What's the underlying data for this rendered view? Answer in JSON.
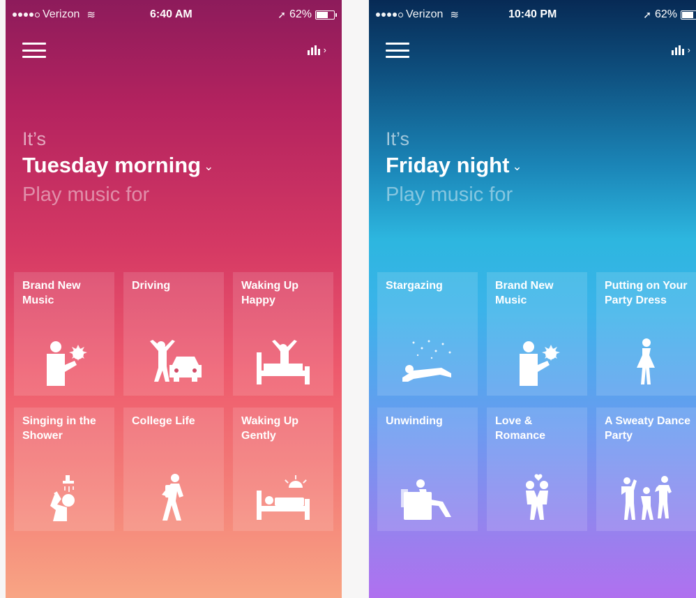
{
  "phones": [
    {
      "status": {
        "carrier": "Verizon",
        "time": "6:40 AM",
        "battery": "62%"
      },
      "greeting": {
        "its": "It’s",
        "period": "Tuesday morning",
        "prompt": "Play music for"
      },
      "tiles": [
        {
          "label": "Brand New Music",
          "icon": "person-with-flower-icon"
        },
        {
          "label": "Driving",
          "icon": "person-car-icon"
        },
        {
          "label": "Waking Up Happy",
          "icon": "person-waking-bed-icon"
        },
        {
          "label": "Singing in the Shower",
          "icon": "person-shower-icon"
        },
        {
          "label": "College Life",
          "icon": "person-walking-backpack-icon"
        },
        {
          "label": "Waking Up Gently",
          "icon": "person-bed-sun-icon"
        }
      ],
      "colors": {
        "top": "#8d1b5b",
        "middle": "#d63a64",
        "bottom": "#f8a584"
      }
    },
    {
      "status": {
        "carrier": "Verizon",
        "time": "10:40 PM",
        "battery": "62%"
      },
      "greeting": {
        "its": "It’s",
        "period": "Friday night",
        "prompt": "Play music for"
      },
      "tiles": [
        {
          "label": "Stargazing",
          "icon": "person-lying-stars-icon"
        },
        {
          "label": "Brand New Music",
          "icon": "person-with-flower-icon"
        },
        {
          "label": "Putting on Your Party Dress",
          "icon": "person-dress-icon"
        },
        {
          "label": "Unwinding",
          "icon": "person-armchair-icon"
        },
        {
          "label": "Love & Romance",
          "icon": "couple-kissing-icon"
        },
        {
          "label": "A Sweaty Dance Party",
          "icon": "people-dancing-icon"
        }
      ],
      "colors": {
        "top": "#072a55",
        "middle": "#2db6df",
        "bottom": "#b070ef"
      }
    }
  ]
}
